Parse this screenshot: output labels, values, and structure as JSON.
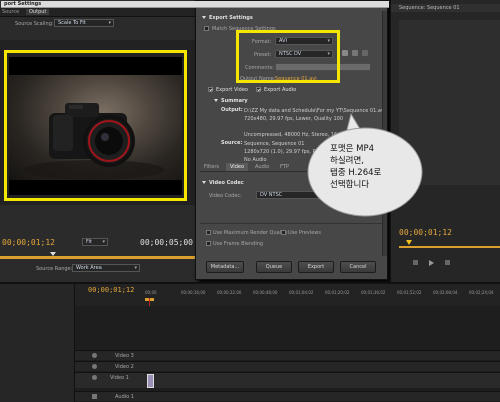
{
  "left_panel": {
    "tabs": [
      "Source",
      "Output"
    ],
    "scaling_label": "Source Scaling:",
    "scaling_value": "Scale To Fit",
    "timecode_in": "00;00;01;12",
    "fit_label": "Fit",
    "timecode_out": "00;00;05;00",
    "source_range_label": "Source Range:",
    "source_range_value": "Work Area"
  },
  "dialog": {
    "title": "port Settings",
    "export_settings_header": "Export Settings",
    "match_sequence": "Match Sequence Settings",
    "format_label": "Format:",
    "format_value": "AVI",
    "preset_label": "Preset:",
    "preset_value": "NTSC DV",
    "comments_label": "Comments:",
    "output_name_label": "Output Name:",
    "output_name_value": "Sequence 01.avi",
    "export_video": "Export Video",
    "export_audio": "Export Audio",
    "summary_header": "Summary",
    "summary_output_label": "Output:",
    "summary_output_lines": [
      "D:\\ZZ My data and Schedule\\For my YT\\Sequence 01.avi",
      "720x480, 29.97 fps, Lower, Quality 100",
      "",
      "Uncompressed, 48000 Hz, Stereo, 16 bit"
    ],
    "summary_source_label": "Source:",
    "summary_source_lines": [
      "Sequence, Sequence 01",
      "1280x720 (1.0), 29.97 fps, Progressive",
      "No Audio"
    ],
    "tabs": [
      "Filters",
      "Video",
      "Audio",
      "FTP"
    ],
    "video_codec_header": "Video Codec",
    "video_codec_label": "Video Codec:",
    "video_codec_value": "DV NTSC",
    "max_render_quality": "Use Maximum Render Quality",
    "use_previews": "Use Previews",
    "frame_blending": "Use Frame Blending",
    "metadata_button": "Metadata...",
    "queue_button": "Queue",
    "export_button": "Export",
    "cancel_button": "Cancel"
  },
  "right_panel": {
    "title": "Sequence: Sequence 01",
    "timecode": "00;00;01;12"
  },
  "timeline": {
    "timecode": "00;00;01;12",
    "ruler_labels": [
      "00;00",
      "00;00;16;00",
      "00;00;32;00",
      "00;00;48;00",
      "00;01;04;02",
      "00;01;20;02",
      "00;01;36;02",
      "00;01;52;02",
      "00;02;08;04",
      "00;02;24;04",
      "00;0"
    ],
    "tracks": [
      "Video 3",
      "Video 2",
      "Video 1",
      "Audio 1"
    ]
  },
  "callout": {
    "lines": [
      "포맷은 MP4",
      "하실려면,",
      "탭중 H.264로",
      "선택합니다"
    ]
  },
  "colors": {
    "highlight": "#f5e600",
    "dialog_bg": "#474747",
    "timecode": "#e4a73a"
  }
}
